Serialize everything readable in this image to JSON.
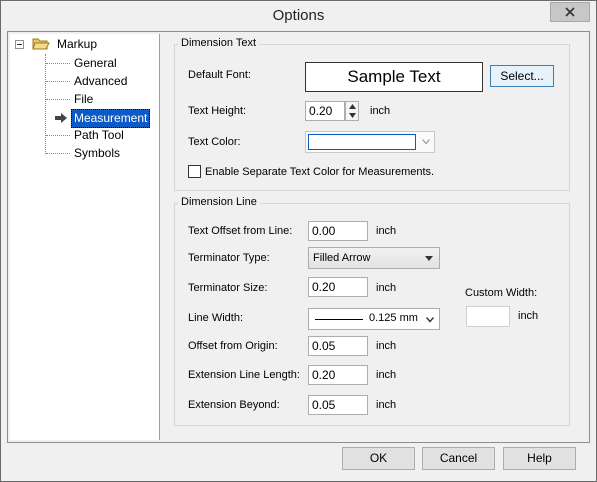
{
  "window": {
    "title": "Options"
  },
  "tree": {
    "root": "Markup",
    "items": [
      "General",
      "Advanced",
      "File",
      "Measurement",
      "Path Tool",
      "Symbols"
    ],
    "selected": "Measurement"
  },
  "dimension_text": {
    "group_label": "Dimension Text",
    "default_font_label": "Default Font:",
    "sample_text": "Sample Text",
    "select_button": "Select...",
    "text_height_label": "Text Height:",
    "text_height_value": "0.20",
    "text_height_unit": "inch",
    "text_color_label": "Text Color:",
    "separate_color_checkbox": "Enable Separate Text Color for Measurements."
  },
  "dimension_line": {
    "group_label": "Dimension Line",
    "text_offset_label": "Text Offset from Line:",
    "text_offset_value": "0.00",
    "text_offset_unit": "inch",
    "terminator_type_label": "Terminator Type:",
    "terminator_type_value": "Filled Arrow",
    "terminator_size_label": "Terminator Size:",
    "terminator_size_value": "0.20",
    "terminator_size_unit": "inch",
    "line_width_label": "Line Width:",
    "line_width_value": "0.125 mm",
    "custom_width_label": "Custom Width:",
    "custom_width_unit": "inch",
    "offset_origin_label": "Offset from Origin:",
    "offset_origin_value": "0.05",
    "offset_origin_unit": "inch",
    "ext_length_label": "Extension Line Length:",
    "ext_length_value": "0.20",
    "ext_length_unit": "inch",
    "ext_beyond_label": "Extension Beyond:",
    "ext_beyond_value": "0.05",
    "ext_beyond_unit": "inch"
  },
  "footer": {
    "ok": "OK",
    "cancel": "Cancel",
    "help": "Help"
  },
  "colors": {
    "selection": "#0a5ac8",
    "folder": "#e8c65a"
  }
}
